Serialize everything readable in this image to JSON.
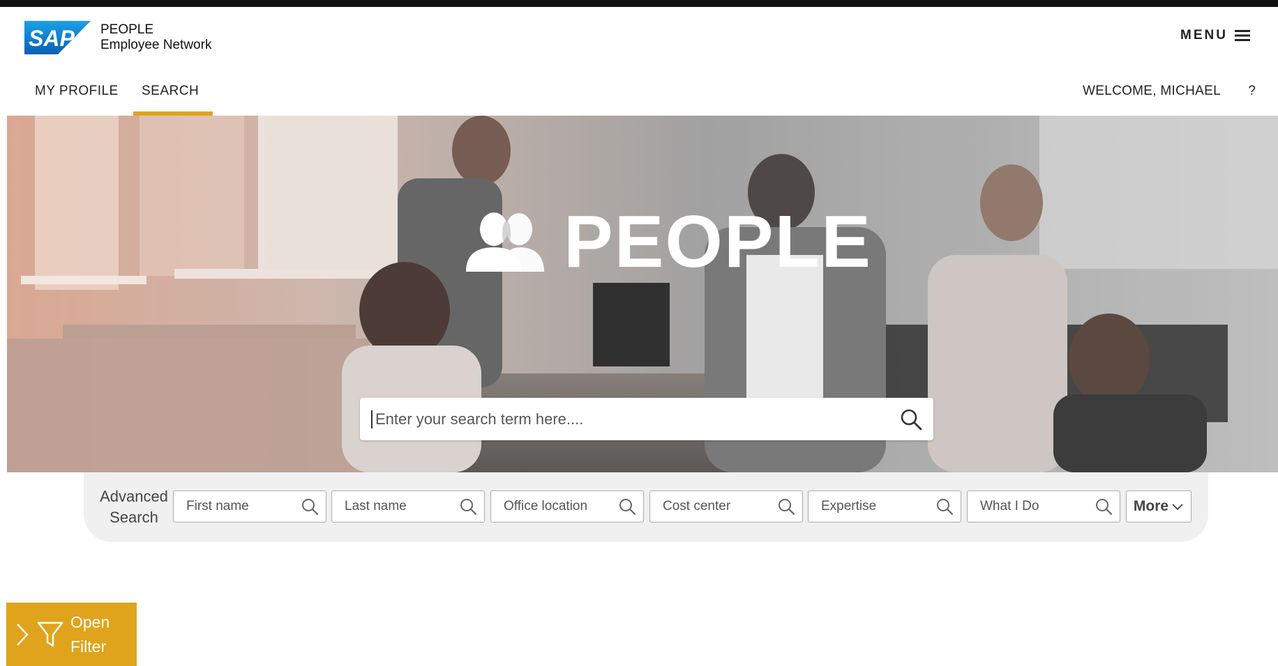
{
  "app": {
    "brand": "SAP",
    "title": "PEOPLE",
    "subtitle": "Employee Network"
  },
  "header": {
    "menu_label": "MENU",
    "menu_icon": "hamburger-icon"
  },
  "nav": {
    "tabs": [
      {
        "label": "MY PROFILE",
        "active": false
      },
      {
        "label": "SEARCH",
        "active": true
      }
    ],
    "welcome": "WELCOME, MICHAEL",
    "help": "?"
  },
  "hero": {
    "title": "PEOPLE",
    "icon": "people-icon",
    "search": {
      "placeholder": "Enter your search term here....",
      "value": ""
    }
  },
  "advanced_search": {
    "label_line1": "Advanced",
    "label_line2": "Search",
    "fields": [
      {
        "placeholder": "First name"
      },
      {
        "placeholder": "Last name"
      },
      {
        "placeholder": "Office location"
      },
      {
        "placeholder": "Cost center"
      },
      {
        "placeholder": "Expertise"
      },
      {
        "placeholder": "What I Do"
      }
    ],
    "more_label": "More"
  },
  "filter": {
    "line1": "Open",
    "line2": "Filter"
  },
  "colors": {
    "accent": "#e0a31c",
    "sap_blue": "#0a6ed1",
    "topbar": "#111111"
  }
}
